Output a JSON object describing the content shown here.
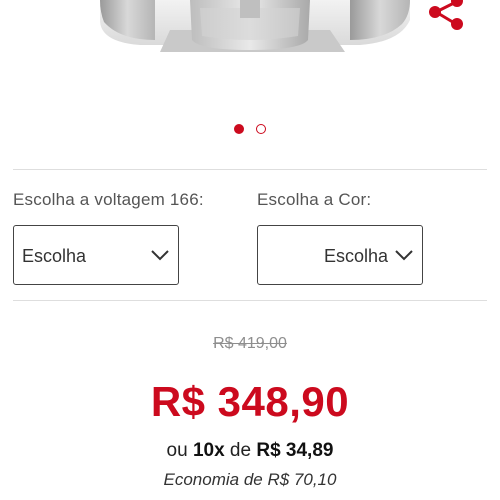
{
  "product": {
    "image_alt": "product-photo"
  },
  "carousel": {
    "dots": [
      {
        "active": true
      },
      {
        "active": false
      }
    ]
  },
  "share": {
    "icon": "share-icon"
  },
  "options": {
    "voltage": {
      "label": "Escolha a voltagem 166:",
      "value": "Escolha"
    },
    "color": {
      "label": "Escolha a Cor:",
      "value": "Escolha"
    }
  },
  "pricing": {
    "old_price": "R$ 419,00",
    "price": "R$ 348,90",
    "installment_prefix": "ou",
    "installment_count": "10x",
    "installment_of": "de",
    "installment_value": "R$ 34,89",
    "savings": "Economia de R$ 70,10"
  },
  "colors": {
    "accent": "#cc0a1e",
    "text": "#333333",
    "muted": "#8e8e8e",
    "divider": "#dedede"
  }
}
